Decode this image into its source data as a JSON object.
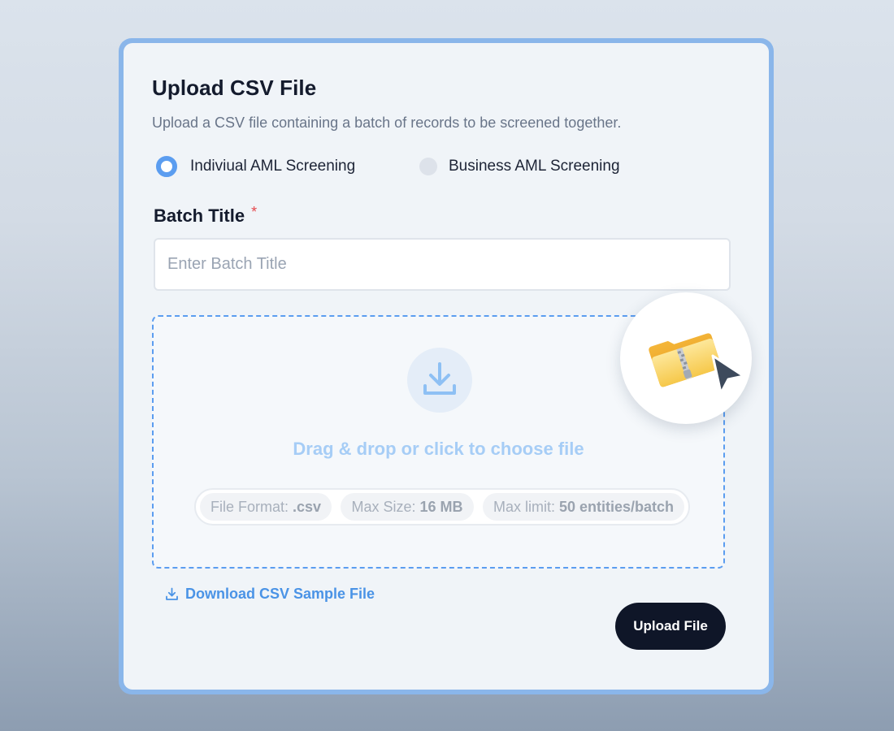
{
  "dialog": {
    "title": "Upload CSV File",
    "subtitle": "Upload a CSV file containing a batch of records to be screened together."
  },
  "screening_type": {
    "options": [
      {
        "label": "Indiviual AML Screening",
        "selected": true
      },
      {
        "label": "Business AML Screening",
        "selected": false
      }
    ]
  },
  "batch_title": {
    "label": "Batch Title",
    "required_marker": "*",
    "placeholder": "Enter Batch Title",
    "value": ""
  },
  "dropzone": {
    "text": "Drag & drop or click to choose file",
    "icon": "download-tray-icon",
    "badge_icon": "zipped-folder-with-cursor-icon",
    "constraints": [
      {
        "label": "File Format:",
        "value": ".csv"
      },
      {
        "label": "Max Size:",
        "value": "16 MB"
      },
      {
        "label": "Max limit:",
        "value": "50 entities/batch"
      }
    ]
  },
  "actions": {
    "download_sample_label": "Download CSV Sample File",
    "download_icon": "download-icon",
    "upload_label": "Upload File"
  },
  "colors": {
    "accent": "#5b9df0",
    "card_border": "#8ab6ea",
    "primary_button": "#0f1628",
    "required": "#e5484d",
    "link": "#4a93e6"
  }
}
